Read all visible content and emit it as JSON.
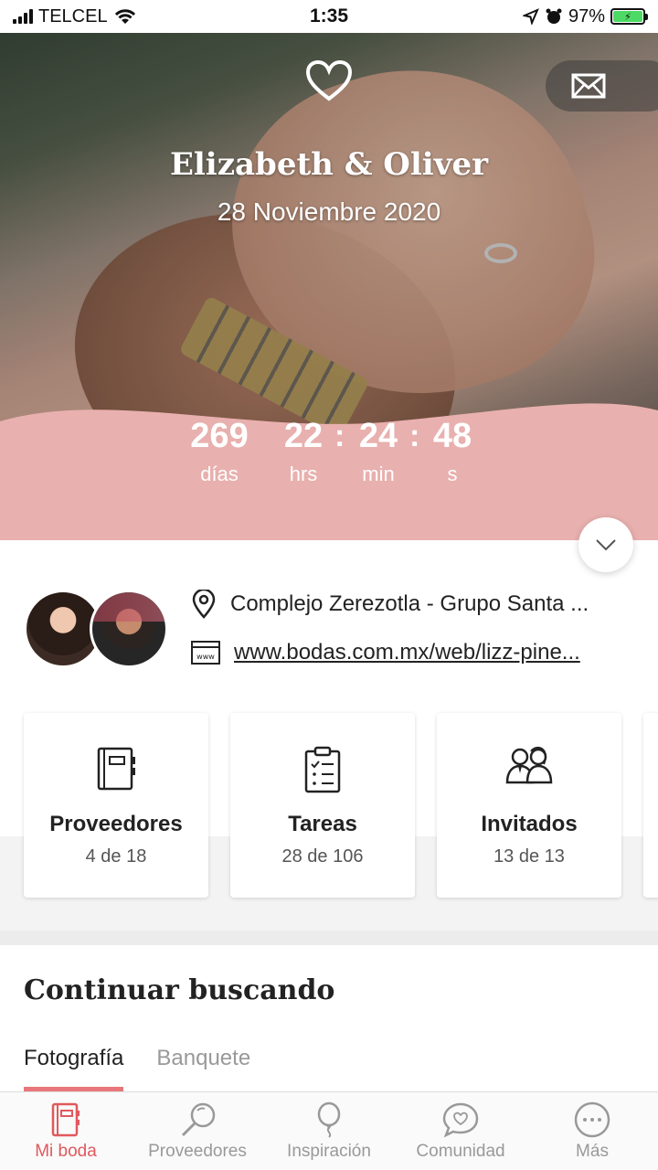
{
  "status_bar": {
    "carrier": "TELCEL",
    "time": "1:35",
    "battery": "97%"
  },
  "hero": {
    "couple": "Elizabeth & Oliver",
    "date": "28 Noviembre 2020",
    "countdown": [
      {
        "value": "269",
        "unit": "días"
      },
      {
        "value": "22",
        "unit": "hrs"
      },
      {
        "value": "24",
        "unit": "min"
      },
      {
        "value": "48",
        "unit": "s"
      }
    ],
    "countdown_color": "#e8b0ae"
  },
  "info": {
    "venue": "Complejo Zerezotla - Grupo Santa ...",
    "website": "www.bodas.com.mx/web/lizz-pine..."
  },
  "cards": [
    {
      "title": "Proveedores",
      "count": "4 de 18",
      "icon": "notebook-icon"
    },
    {
      "title": "Tareas",
      "count": "28 de 106",
      "icon": "clipboard-checklist-icon"
    },
    {
      "title": "Invitados",
      "count": "13 de 13",
      "icon": "guests-icon"
    }
  ],
  "continue": {
    "title": "Continuar buscando",
    "tabs": [
      "Fotografía",
      "Banquete"
    ]
  },
  "bottom_nav": [
    {
      "label": "Mi boda",
      "icon": "wedding-book-icon"
    },
    {
      "label": "Proveedores",
      "icon": "search-icon"
    },
    {
      "label": "Inspiración",
      "icon": "balloon-icon"
    },
    {
      "label": "Comunidad",
      "icon": "chat-heart-icon"
    },
    {
      "label": "Más",
      "icon": "more-icon"
    }
  ],
  "accent": "#e0595e"
}
